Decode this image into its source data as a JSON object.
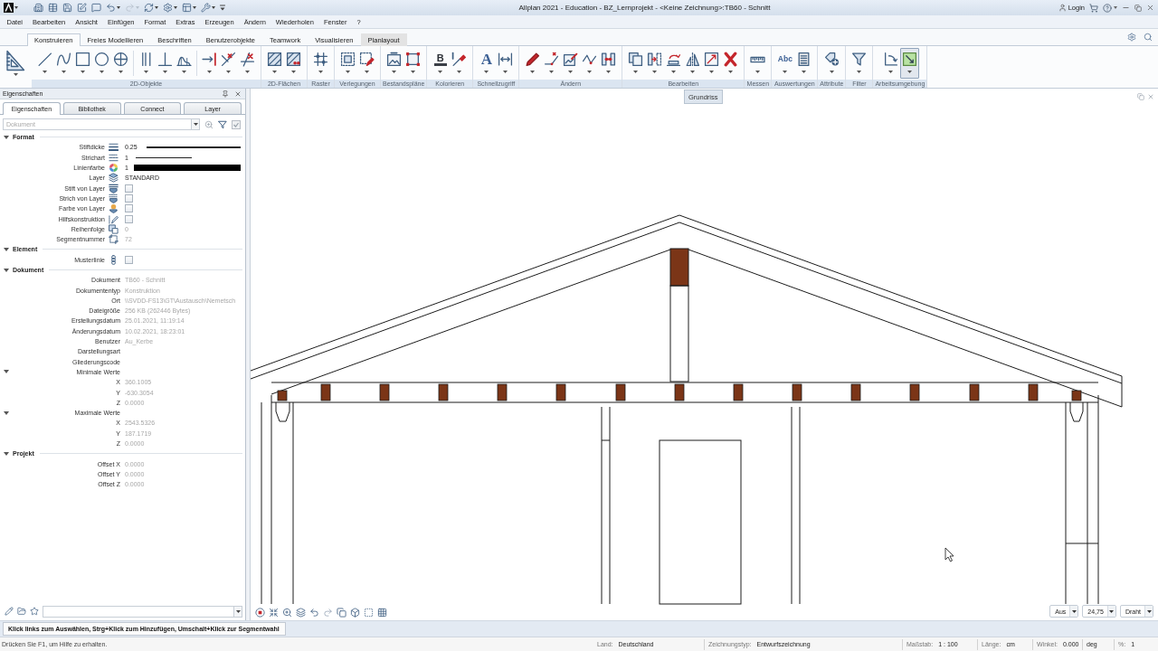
{
  "window": {
    "title": "Allplan 2021 - Education - BZ_Lernprojekt - <Keine Zeichnung>:TB60 - Schnitt",
    "login": "Login"
  },
  "quick_access": [
    {
      "dropdown": true,
      "disabled": false
    },
    {
      "dropdown": false,
      "disabled": false
    },
    {
      "dropdown": false,
      "disabled": false
    },
    {
      "dropdown": false,
      "disabled": false
    },
    {
      "dropdown": false,
      "disabled": false
    },
    {
      "dropdown": false,
      "disabled": false
    },
    {
      "dropdown": true,
      "disabled": false
    },
    {
      "dropdown": true,
      "disabled": true
    },
    {
      "dropdown": true,
      "disabled": false
    },
    {
      "dropdown": true,
      "disabled": false
    },
    {
      "dropdown": true,
      "disabled": false
    },
    {
      "dropdown": true,
      "disabled": false
    },
    {
      "dropdown": false,
      "disabled": false
    }
  ],
  "menu": [
    "Datei",
    "Bearbeiten",
    "Ansicht",
    "Einfügen",
    "Format",
    "Extras",
    "Erzeugen",
    "Ändern",
    "Wiederholen",
    "Fenster",
    "?"
  ],
  "ribbon": {
    "tabs": [
      {
        "label": "Konstruieren",
        "selected": true,
        "hovered": false
      },
      {
        "label": "Freies Modellieren",
        "selected": false,
        "hovered": false
      },
      {
        "label": "Beschriften",
        "selected": false,
        "hovered": false
      },
      {
        "label": "Benutzerobjekte",
        "selected": false,
        "hovered": false
      },
      {
        "label": "Teamwork",
        "selected": false,
        "hovered": false
      },
      {
        "label": "Visualisieren",
        "selected": false,
        "hovered": false
      },
      {
        "label": "Planlayout",
        "selected": false,
        "hovered": true
      }
    ],
    "groups": [
      {
        "tools": [
          {
            "selected": false
          }
        ]
      },
      {
        "label": "2D-Objekte",
        "tools": [
          {
            "selected": false
          },
          {
            "selected": false
          },
          {
            "selected": false
          },
          {
            "selected": false
          },
          {
            "selected": false
          },
          {
            "selected": false
          },
          {
            "selected": false
          },
          {
            "selected": false
          },
          {
            "selected": false
          },
          {
            "selected": false
          },
          {
            "selected": false
          }
        ]
      },
      {
        "label": "2D-Flächen",
        "tools": [
          {
            "selected": false
          },
          {
            "selected": false
          }
        ]
      },
      {
        "label": "Raster",
        "tools": [
          {
            "selected": false
          }
        ]
      },
      {
        "label": "Verlegungen",
        "tools": [
          {
            "selected": false
          },
          {
            "selected": false
          }
        ]
      },
      {
        "label": "Bestandspläne",
        "tools": [
          {
            "selected": false
          },
          {
            "selected": false
          }
        ]
      },
      {
        "label": "Kolorieren",
        "tools": [
          {
            "selected": false,
            "glyph": "B"
          },
          {
            "selected": false
          }
        ]
      },
      {
        "label": "Schnellzugriff",
        "tools": [
          {
            "selected": false,
            "glyph": "A"
          },
          {
            "selected": false
          }
        ]
      },
      {
        "label": "Ändern",
        "tools": [
          {
            "selected": false
          },
          {
            "selected": false
          },
          {
            "selected": false
          },
          {
            "selected": false
          },
          {
            "selected": false
          }
        ]
      },
      {
        "label": "Bearbeiten",
        "tools": [
          {
            "selected": false
          },
          {
            "selected": false
          },
          {
            "selected": false
          },
          {
            "selected": false
          },
          {
            "selected": false
          },
          {
            "selected": false
          }
        ]
      },
      {
        "label": "Messen",
        "tools": [
          {
            "selected": false
          }
        ]
      },
      {
        "label": "Auswertungen",
        "tools": [
          {
            "selected": false,
            "glyph": "Abc"
          },
          {
            "selected": false
          }
        ]
      },
      {
        "label": "Attribute",
        "tools": [
          {
            "selected": false
          }
        ]
      },
      {
        "label": "Filter",
        "tools": [
          {
            "selected": false
          }
        ]
      },
      {
        "label": "Arbeitsumgebung",
        "tools": [
          {
            "selected": false
          },
          {
            "selected": true
          }
        ]
      }
    ]
  },
  "properties": {
    "title": "Eigenschaften",
    "tabs": [
      {
        "label": "Eigenschaften",
        "selected": true
      },
      {
        "label": "Bibliothek",
        "selected": false
      },
      {
        "label": "Connect",
        "selected": false
      },
      {
        "label": "Layer",
        "selected": false
      }
    ],
    "filter": {
      "placeholder": "Dokument"
    },
    "sections": [
      {
        "title": "Format",
        "expanded": true,
        "rows": [
          {
            "kind": "pen",
            "label": "Stiftdicke",
            "value": "0.25",
            "disabled": false
          },
          {
            "kind": "linetype",
            "label": "Strichart",
            "value": "1",
            "disabled": false
          },
          {
            "kind": "color",
            "label": "Linienfarbe",
            "value": "1",
            "color": "#000000",
            "disabled": false
          },
          {
            "kind": "text",
            "label": "Layer",
            "value": "STANDARD",
            "disabled": false
          },
          {
            "kind": "checkbox",
            "label": "Stift von Layer",
            "checked": false
          },
          {
            "kind": "checkbox",
            "label": "Strich von Layer",
            "checked": false
          },
          {
            "kind": "checkbox",
            "label": "Farbe von Layer",
            "checked": false
          },
          {
            "kind": "checkbox",
            "label": "Hilfskonstruktion",
            "checked": false
          },
          {
            "kind": "text",
            "label": "Reihenfolge",
            "value": "0",
            "disabled": true
          },
          {
            "kind": "text",
            "label": "Segmentnummer",
            "value": "72",
            "disabled": true
          }
        ]
      },
      {
        "title": "Element",
        "expanded": true,
        "rows": [
          {
            "kind": "checkbox",
            "label": "Musterlinie",
            "checked": false
          }
        ]
      },
      {
        "title": "Dokument",
        "expanded": true,
        "rows": [
          {
            "kind": "text",
            "label": "Dokument",
            "value": "TB60 - Schnitt",
            "disabled": true
          },
          {
            "kind": "text",
            "label": "Dokumententyp",
            "value": "Konstruktion",
            "disabled": true
          },
          {
            "kind": "text",
            "label": "Ort",
            "value": "\\\\SVDD-FS13\\GT\\Austausch\\Nemetsch",
            "disabled": true
          },
          {
            "kind": "text",
            "label": "Dateigröße",
            "value": "256 KB (262446 Bytes)",
            "disabled": true
          },
          {
            "kind": "text",
            "label": "Erstellungsdatum",
            "value": "25.01.2021, 11:19:14",
            "disabled": true
          },
          {
            "kind": "text",
            "label": "Änderungsdatum",
            "value": "10.02.2021, 18:23:01",
            "disabled": true
          },
          {
            "kind": "text",
            "label": "Benutzer",
            "value": "Au_Kerbe",
            "disabled": true
          },
          {
            "kind": "text",
            "label": "Darstellungsart"
          },
          {
            "kind": "text",
            "label": "Gliederungscode"
          },
          {
            "kind": "group",
            "label": "Minimale Werte",
            "expanded": true,
            "children": [
              {
                "kind": "text",
                "label": "X",
                "value": "360.1005",
                "disabled": true
              },
              {
                "kind": "text",
                "label": "Y",
                "value": "-630.3054",
                "disabled": true
              },
              {
                "kind": "text",
                "label": "Z",
                "value": "0.0000",
                "disabled": true
              }
            ]
          },
          {
            "kind": "group",
            "label": "Maximale Werte",
            "expanded": true,
            "children": [
              {
                "kind": "text",
                "label": "X",
                "value": "2543.5326",
                "disabled": true
              },
              {
                "kind": "text",
                "label": "Y",
                "value": "187.1719",
                "disabled": true
              },
              {
                "kind": "text",
                "label": "Z",
                "value": "0.0000",
                "disabled": true
              }
            ]
          }
        ]
      },
      {
        "title": "Projekt",
        "expanded": true,
        "rows": [
          {
            "kind": "text",
            "label": "Offset X",
            "value": "0.0000",
            "disabled": true
          },
          {
            "kind": "text",
            "label": "Offset Y",
            "value": "0.0000",
            "disabled": true
          },
          {
            "kind": "text",
            "label": "Offset Z",
            "value": "0.0000",
            "disabled": true
          }
        ]
      }
    ]
  },
  "canvas": {
    "view_tab": "Grundriss",
    "view_controls": [
      {
        "value": "Aus"
      },
      {
        "value": "24,75"
      },
      {
        "value": "Draht"
      }
    ]
  },
  "hint": "Klick links zum Auswählen, Strg+Klick zum Hinzufügen, Umschalt+Klick zur Segmentwahl",
  "status_bar": {
    "help": "Drücken Sie F1, um Hilfe zu erhalten.",
    "fields": [
      {
        "label": "Land:",
        "value": "Deutschland"
      },
      {
        "label": "Zeichnungstyp:",
        "value": "Entwurfszeichnung"
      },
      {
        "label": "Maßstab:",
        "value": "1 : 100"
      },
      {
        "label": "Länge:",
        "value": "cm"
      },
      {
        "label": "Winkel:",
        "value": "0.000"
      },
      {
        "value": "deg"
      },
      {
        "label": "%:",
        "value": "1"
      }
    ]
  }
}
